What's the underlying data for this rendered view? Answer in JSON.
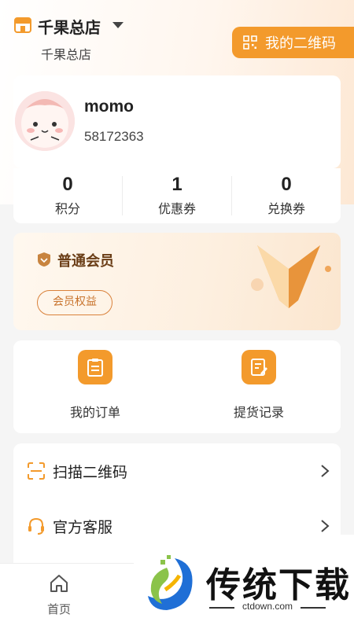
{
  "header": {
    "store_name": "千果总店",
    "store_sub": "千果总店",
    "qr_button_label": "我的二维码"
  },
  "profile": {
    "username": "momo",
    "user_id": "58172363"
  },
  "stats": [
    {
      "value": "0",
      "label": "积分"
    },
    {
      "value": "1",
      "label": "优惠券"
    },
    {
      "value": "0",
      "label": "兑换券"
    }
  ],
  "member": {
    "level": "普通会员",
    "benefit_button": "会员权益"
  },
  "orders": [
    {
      "label": "我的订单",
      "icon": "order-list-icon"
    },
    {
      "label": "提货记录",
      "icon": "pickup-record-icon"
    }
  ],
  "menu": [
    {
      "label": "扫描二维码",
      "icon": "scan-icon"
    },
    {
      "label": "官方客服",
      "icon": "headset-icon"
    }
  ],
  "tabbar": {
    "home_label": "首页"
  },
  "watermark": {
    "text": "传统下载",
    "url": "ctdown.com"
  },
  "colors": {
    "accent": "#f39a2c",
    "member_text": "#6a3d16"
  }
}
